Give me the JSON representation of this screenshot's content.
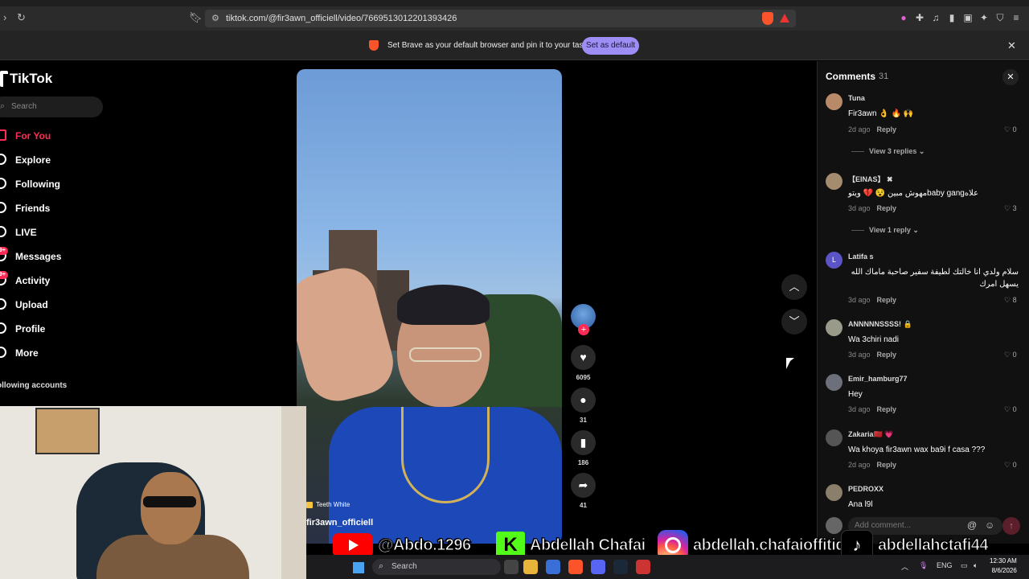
{
  "browser": {
    "url": "tiktok.com/@fir3awn_officiell/video/7669513012201393426",
    "infobar_message": "Set Brave as your default browser and pin it to your taskbar",
    "infobar_button": "Set as default"
  },
  "sidebar": {
    "logo": "TikTok",
    "search_placeholder": "Search",
    "items": [
      {
        "label": "For You",
        "icon": "home-icon",
        "active": true
      },
      {
        "label": "Explore",
        "icon": "compass-icon"
      },
      {
        "label": "Following",
        "icon": "following-icon"
      },
      {
        "label": "Friends",
        "icon": "friends-icon"
      },
      {
        "label": "LIVE",
        "icon": "live-icon"
      },
      {
        "label": "Messages",
        "icon": "messages-icon",
        "badge": "9+"
      },
      {
        "label": "Activity",
        "icon": "activity-icon",
        "badge": "9+"
      },
      {
        "label": "Upload",
        "icon": "upload-icon"
      },
      {
        "label": "Profile",
        "icon": "profile-icon"
      },
      {
        "label": "More",
        "icon": "more-icon"
      }
    ],
    "following_header": "ollowing accounts"
  },
  "video": {
    "tag": "Teeth White",
    "author": "fir3awn_officiell"
  },
  "actions": {
    "likes": "6095",
    "comments": "31",
    "saves": "186",
    "shares": "41"
  },
  "comments_panel": {
    "title": "Comments",
    "count": "31",
    "add_placeholder": "Add comment...",
    "comments": [
      {
        "user": "Tuna",
        "text": "Fir3awn 👌 🔥 🙌",
        "date": "2d ago",
        "likes": "0",
        "reply": "Reply",
        "view": "View 3 replies"
      },
      {
        "user": "【EINAS】 ✖",
        "text": "مهوش مبين 😵 💔 ويتوbaby gangعلاه",
        "date": "3d ago",
        "likes": "3",
        "reply": "Reply",
        "view": "View 1 reply"
      },
      {
        "user": "Latifa s",
        "text": "سلام ولدي انا خالتك لطيفة سفير صاحبة ماماك الله يسهل امرك",
        "date": "3d ago",
        "likes": "8",
        "reply": "Reply"
      },
      {
        "user": "ANNNNNSSSS! 🔒",
        "text": "Wa 3chiri nadi",
        "date": "3d ago",
        "likes": "0",
        "reply": "Reply"
      },
      {
        "user": "Emir_hamburg77",
        "text": "Hey",
        "date": "3d ago",
        "likes": "0",
        "reply": "Reply"
      },
      {
        "user": "Zakaria🇲🇦 💗",
        "text": "Wa khoya fir3awn wax ba9i f casa ???",
        "date": "2d ago",
        "likes": "0",
        "reply": "Reply"
      },
      {
        "user": "PEDROXX",
        "text": "Ana l9l",
        "date": "",
        "likes": "",
        "reply": ""
      }
    ]
  },
  "banner": {
    "youtube": "@Abdo.1296",
    "kick": "Abdellah Chafai",
    "instagram": "abdellah.chafaioffitid",
    "tiktok": "abdellahctafi44"
  },
  "taskbar": {
    "search": "Search",
    "lang": "ENG",
    "time": "12:30 AM",
    "date": "8/6/2026"
  }
}
